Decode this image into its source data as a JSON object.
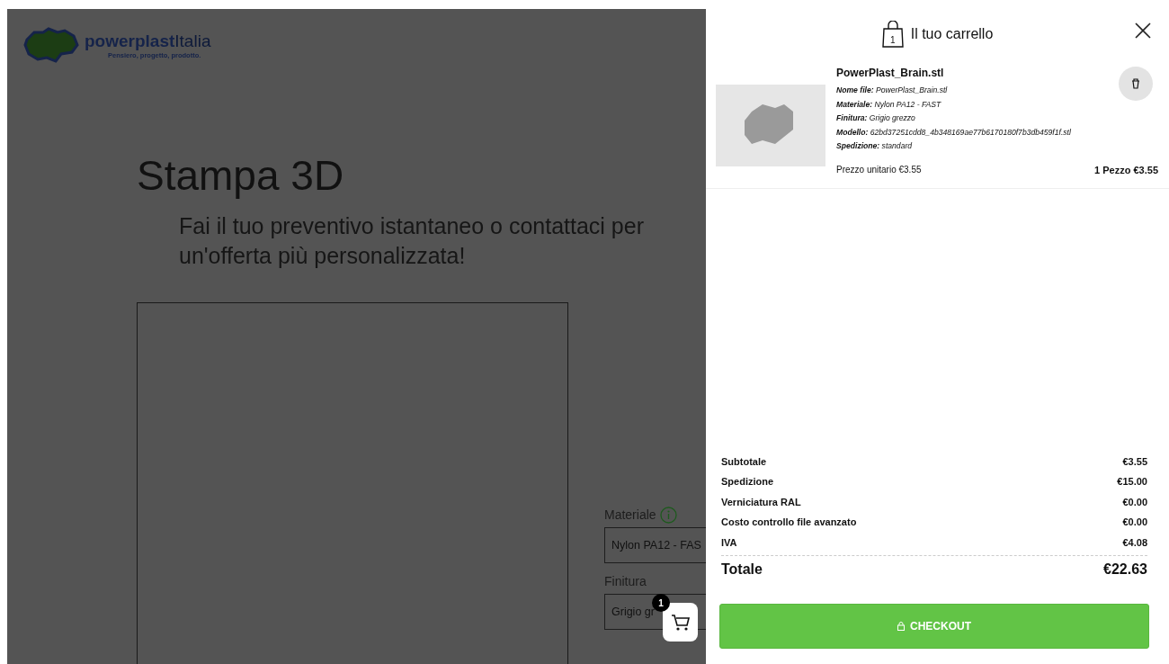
{
  "page": {
    "logo": {
      "name": "powerplast",
      "suffix": "Italia",
      "tagline": "Pensiero, progetto, prodotto."
    },
    "heading": "Stampa 3D",
    "subheading": "Fai il tuo preventivo istantaneo o contattaci per un'offerta più personalizzata!",
    "fields": [
      {
        "label": "Materiale",
        "info": true,
        "value": "Nylon PA12 - FAS"
      },
      {
        "label": "Finitura",
        "info": false,
        "value": "Grigio gr"
      }
    ],
    "cart_button": {
      "badge": "1"
    }
  },
  "cart": {
    "title": "Il tuo carrello",
    "bag_count": "1",
    "items": [
      {
        "name": "PowerPlast_Brain.stl",
        "details": [
          "**Nome file:** PowerPlast_Brain.stl",
          "**Materiale:** Nylon PA12 - FAST",
          "**Finitura:** Grigio grezzo",
          "**Modello:** 62bd37251cdd8_4b348169ae77b6170180f7b3db459f1f.stl",
          "**Spedizione:** standard"
        ],
        "unit_price_label": "Prezzo unitario",
        "unit_price": "€3.55",
        "quantity_total": "1 Pezzo €3.55"
      }
    ],
    "summary": [
      {
        "label": "Subtotale",
        "value": "€3.55"
      },
      {
        "label": "Spedizione",
        "value": "€15.00"
      },
      {
        "label": "Verniciatura RAL",
        "value": "€0.00"
      },
      {
        "label": "Costo controllo file avanzato",
        "value": "€0.00"
      },
      {
        "label": "IVA",
        "value": "€4.08"
      }
    ],
    "total": {
      "label": "Totale",
      "value": "€22.63"
    },
    "checkout": "CHECKOUT"
  }
}
